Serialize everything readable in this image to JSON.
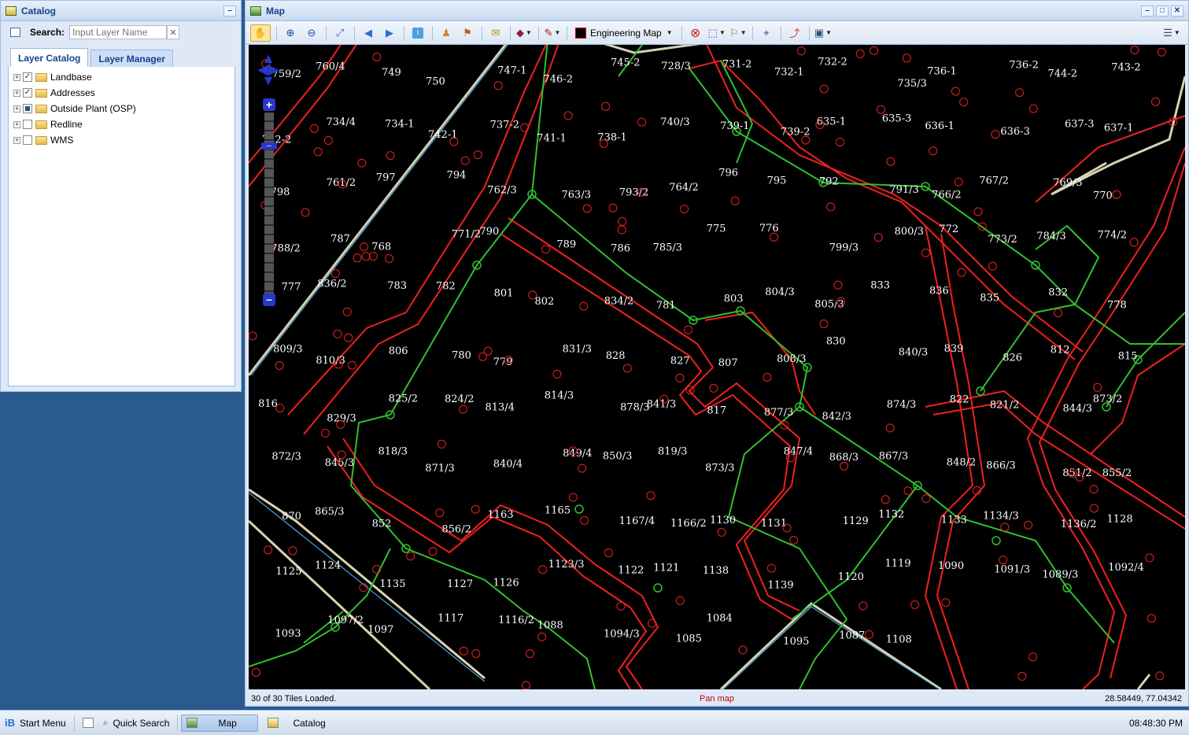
{
  "catalog": {
    "title": "Catalog",
    "search_label": "Search:",
    "search_placeholder": "Input Layer Name",
    "clear_glyph": "✕",
    "tabs": [
      {
        "label": "Layer Catalog",
        "active": true
      },
      {
        "label": "Layer Manager",
        "active": false
      }
    ],
    "layers": [
      {
        "label": "Landbase",
        "state": "checked"
      },
      {
        "label": "Addresses",
        "state": "checked"
      },
      {
        "label": "Outside Plant (OSP)",
        "state": "partial"
      },
      {
        "label": "Redline",
        "state": "unchecked"
      },
      {
        "label": "WMS",
        "state": "unchecked"
      }
    ]
  },
  "map": {
    "title": "Map",
    "style_select": "Engineering Map",
    "status_left": "30 of 30 Tiles Loaded.",
    "status_center": "Pan map",
    "status_right": "28.58449, 77.04342",
    "labels": [
      "759/2",
      "760/4",
      "749",
      "750",
      "747-1",
      "746-2",
      "745-2",
      "728/3",
      "731-2",
      "732-1",
      "732-2",
      "735/3",
      "736-1",
      "736-2",
      "744-2",
      "743-2",
      "742-2",
      "734/4",
      "734-1",
      "742-1",
      "737-2",
      "741-1",
      "738-1",
      "740/3",
      "739-1",
      "739-2",
      "635-1",
      "635-3",
      "636-1",
      "636-3",
      "637-3",
      "637-1",
      "798",
      "761/2",
      "797",
      "794",
      "762/3",
      "763/3",
      "793/2",
      "764/2",
      "796",
      "795",
      "792",
      "791/3",
      "766/2",
      "767/2",
      "769/3",
      "770",
      "788/2",
      "787",
      "768",
      "771/2",
      "790",
      "789",
      "786",
      "785/3",
      "775",
      "776",
      "799/3",
      "800/3",
      "772",
      "773/2",
      "784/3",
      "774/2",
      "777",
      "836/2",
      "783",
      "782",
      "801",
      "802",
      "834/2",
      "781",
      "803",
      "804/3",
      "805/3",
      "833",
      "836",
      "835",
      "832",
      "778",
      "809/3",
      "810/3",
      "806",
      "780",
      "779",
      "831/3",
      "828",
      "827",
      "807",
      "808/3",
      "830",
      "840/3",
      "839",
      "826",
      "812",
      "815",
      "816",
      "829/3",
      "825/2",
      "824/2",
      "813/4",
      "814/3",
      "878/3",
      "841/3",
      "817",
      "877/3",
      "842/3",
      "874/3",
      "822",
      "821/2",
      "844/3",
      "873/2",
      "872/3",
      "845/3",
      "818/3",
      "871/3",
      "840/4",
      "849/4",
      "850/3",
      "819/3",
      "873/3",
      "847/4",
      "868/3",
      "867/3",
      "848/2",
      "866/3",
      "851/2",
      "855/2",
      "870",
      "865/3",
      "852",
      "856/2",
      "1163",
      "1165",
      "1167/4",
      "1166/2",
      "1130",
      "1131",
      "1129",
      "1132",
      "1133",
      "1134/3",
      "1136/2",
      "1128",
      "1125",
      "1124",
      "1135",
      "1127",
      "1126",
      "1123/3",
      "1122",
      "1121",
      "1138",
      "1139",
      "1120",
      "1119",
      "1090",
      "1091/3",
      "1089/3",
      "1092/4",
      "1093",
      "1097/2",
      "1097",
      "1117",
      "1116/2",
      "1088",
      "1094/3",
      "1085",
      "1084",
      "1095",
      "1087",
      "1108"
    ],
    "toolbar": [
      "pan-tool",
      "zoom-in",
      "zoom-out",
      "full-extent",
      "previous-extent",
      "next-extent",
      "identify",
      "street-view",
      "measure",
      "email",
      "layers",
      "redline",
      "style-select",
      "clear",
      "select",
      "tools",
      "locate",
      "route",
      "print",
      "more"
    ]
  },
  "taskbar": {
    "start_menu": "Start Menu",
    "quick_search": "Quick Search",
    "map_task": "Map",
    "catalog_task": "Catalog",
    "clock": "08:48:30 PM"
  }
}
